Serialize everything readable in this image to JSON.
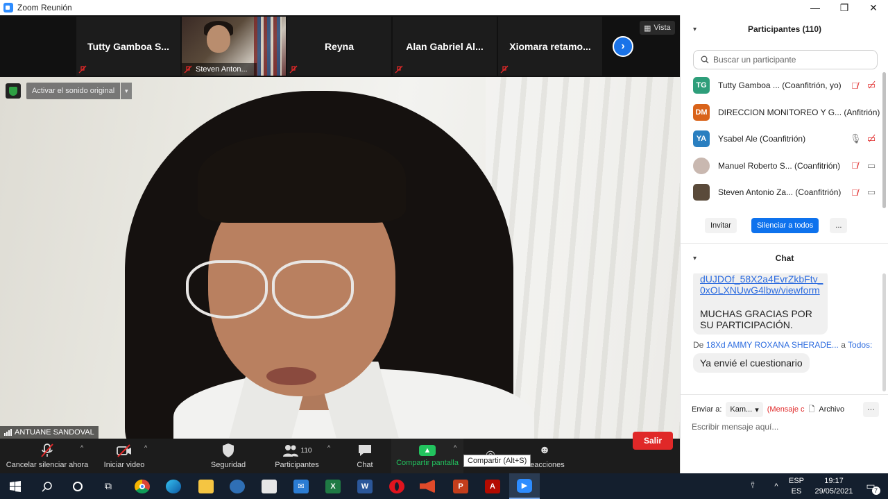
{
  "window": {
    "title": "Zoom Reunión",
    "controls": [
      "—",
      "❐",
      "✕"
    ]
  },
  "strip": {
    "thumbnails": [
      {
        "name": "Tutty Gamboa S...",
        "muted": true,
        "video": false
      },
      {
        "name": "Steven Anton...",
        "muted": true,
        "video": true
      },
      {
        "name": "Reyna",
        "muted": true,
        "video": false
      },
      {
        "name": "Alan Gabriel Al...",
        "muted": true,
        "video": false
      },
      {
        "name": "Xiomara  retamo...",
        "muted": true,
        "video": false
      }
    ],
    "next_icon": "›",
    "view_label": "Vista"
  },
  "main_video": {
    "sound_button": "Activar el sonido original",
    "sound_arrow": "▾",
    "speaker_name": "ANTUANE SANDOVAL"
  },
  "toolbar": {
    "mute_label": "Cancelar silenciar ahora",
    "video_label": "Iniciar video",
    "security_label": "Seguridad",
    "participants_label": "Participantes",
    "participants_count": "110",
    "chat_label": "Chat",
    "share_label": "Compartir pantalla",
    "reactions_label": "Reacciones",
    "share_tooltip": "Compartir (Alt+S)",
    "exit_label": "Salir",
    "caret": "^"
  },
  "participants_panel": {
    "title": "Participantes (110)",
    "search_placeholder": "Buscar un participante",
    "participants": [
      {
        "initials": "TG",
        "color": "#2e9e7a",
        "name": "Tutty Gamboa ...  (Coanfitrión, yo)",
        "mic": "muted",
        "video": "off"
      },
      {
        "initials": "DM",
        "color": "#d9631a",
        "name": "DIRECCION MONITOREO Y G...  (Anfitrión)",
        "mic": "none",
        "video": "off"
      },
      {
        "initials": "YA",
        "color": "#2a7fc0",
        "name": "Ysabel Ale (Coanfitrión)",
        "mic": "on",
        "video": "off"
      },
      {
        "initials": "",
        "color": "#c9b8b0",
        "name": "Manuel Roberto S...  (Coanfitrión)",
        "mic": "muted",
        "video": "on"
      },
      {
        "initials": "",
        "color": "#5a4a3a",
        "name": "Steven Antonio Za...  (Coanfitrión)",
        "mic": "muted",
        "video": "on"
      }
    ],
    "invite_label": "Invitar",
    "mute_all_label": "Silenciar a todos",
    "more_label": "..."
  },
  "chat_panel": {
    "title": "Chat",
    "messages": [
      {
        "type": "link",
        "lines": [
          "dUJDOf_58X2a4EvrZkbFtv_",
          "0xOLXNUwG4lbw/viewform"
        ],
        "text": "MUCHAS GRACIAS POR SU PARTICIPACIÓN."
      },
      {
        "type": "text",
        "from_prefix": "De",
        "from": "18Xd AMMY ROXANA SHERADE...",
        "to_prefix": "a",
        "to": "Todos:",
        "text": "Ya envié el cuestionario"
      }
    ],
    "send_to_label": "Enviar a:",
    "send_to_value": "Kam...",
    "private_label": "(Mensaje c",
    "file_label": "Archivo",
    "more_label": "···",
    "compose_placeholder": "Escribir mensaje aquí..."
  },
  "taskbar": {
    "apps": [
      "start",
      "search",
      "cortana",
      "task-view",
      "chrome",
      "edge",
      "file-explorer",
      "photos",
      "store",
      "mail",
      "excel",
      "word",
      "opera",
      "audio",
      "powerpoint",
      "acrobat",
      "zoom"
    ],
    "lang_top": "ESP",
    "lang_bottom": "ES",
    "time": "19:17",
    "date": "29/05/2021",
    "notifications": "7"
  },
  "colors": {
    "accent": "#0e72ed",
    "share_green": "#22c35e",
    "exit_red": "#e02828",
    "toolbar_bg": "#1c1c1c",
    "taskbar_bg": "#141f2e"
  }
}
